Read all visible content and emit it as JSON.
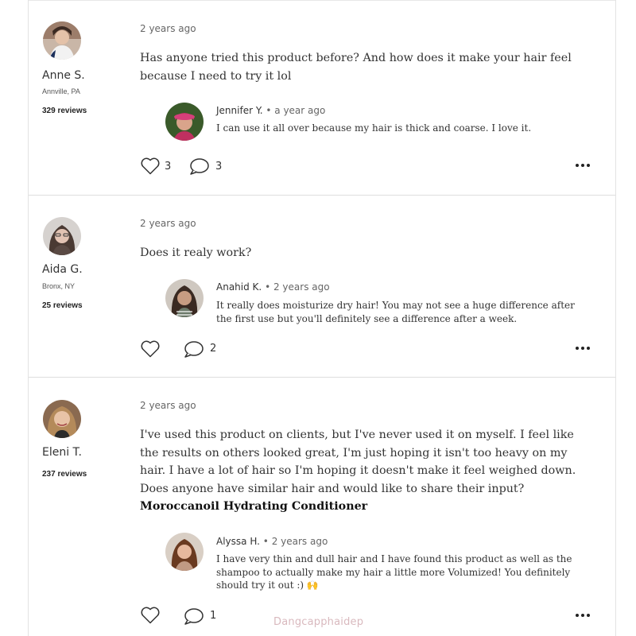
{
  "posts": [
    {
      "author": {
        "name": "Anne S.",
        "location": "Annville, PA",
        "reviews": "329 reviews"
      },
      "time": "2 years ago",
      "question": "Has anyone tried this product before? And how does it make your hair feel because I need to try it lol",
      "reply": {
        "name": "Jennifer Y.",
        "time": "a year ago",
        "text": "I can use it all over because my hair is thick and coarse. I love it."
      },
      "likes": "3",
      "comments": "3"
    },
    {
      "author": {
        "name": "Aida G.",
        "location": "Bronx, NY",
        "reviews": "25 reviews"
      },
      "time": "2 years ago",
      "question": "Does it realy work?",
      "reply": {
        "name": "Anahid K.",
        "time": "2 years ago",
        "text": "It really does moisturize dry hair! You may not see a huge difference after the first use but you'll definitely see a difference after a week."
      },
      "likes": "",
      "comments": "2"
    },
    {
      "author": {
        "name": "Eleni T.",
        "location": "",
        "reviews": "237 reviews"
      },
      "time": "2 years ago",
      "question": "I've used this product on clients, but I've never used it on myself. I feel like the results on others looked great, I'm just hoping it isn't too heavy on my hair. I have a lot of hair so I'm hoping it doesn't make it feel weighed down. Does anyone have similar hair and would like to share their input?",
      "product_link": "Moroccanoil Hydrating Conditioner",
      "reply": {
        "name": "Alyssa H.",
        "time": "2 years ago",
        "text": "I have very thin and dull hair and I have found this product as well as the shampoo to actually make my hair a little more Volumized! You definitely should try it out :) 🙌"
      },
      "likes": "",
      "comments": "1"
    }
  ],
  "separator": "•",
  "watermark": "Dangcapphaidep",
  "icons": [
    "heart-icon",
    "comment-icon",
    "more-options-icon"
  ],
  "colors": {
    "divider": "#dedede",
    "text": "#333333",
    "muted": "#666666",
    "watermark": "#d9b9be"
  }
}
